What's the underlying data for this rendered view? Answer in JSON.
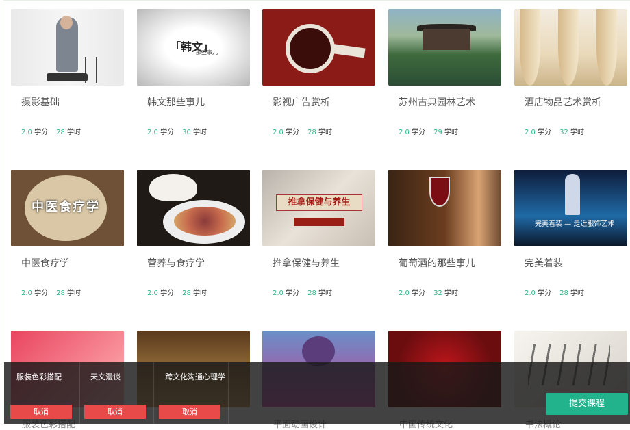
{
  "courses_row1": [
    {
      "title": "摄影基础",
      "credits": "2.0",
      "hours": "28",
      "thumb": "t-photo"
    },
    {
      "title": "韩文那些事儿",
      "credits": "2.0",
      "hours": "30",
      "thumb": "t-hanwen",
      "thumb_text": "「韩文」",
      "thumb_sub": "那些事儿"
    },
    {
      "title": "影视广告赏析",
      "credits": "2.0",
      "hours": "28",
      "thumb": "t-film"
    },
    {
      "title": "苏州古典园林艺术",
      "credits": "2.0",
      "hours": "29",
      "thumb": "t-garden"
    },
    {
      "title": "酒店物品艺术赏析",
      "credits": "2.0",
      "hours": "32",
      "thumb": "t-hotel"
    }
  ],
  "courses_row2": [
    {
      "title": "中医食疗学",
      "credits": "2.0",
      "hours": "28",
      "thumb": "t-tcm",
      "thumb_text": "中医食疗学"
    },
    {
      "title": "营养与食疗学",
      "credits": "2.0",
      "hours": "28",
      "thumb": "t-nutri"
    },
    {
      "title": "推拿保健与养生",
      "credits": "2.0",
      "hours": "28",
      "thumb": "t-massage",
      "thumb_text": "推拿保健与养生"
    },
    {
      "title": "葡萄酒的那些事儿",
      "credits": "2.0",
      "hours": "32",
      "thumb": "t-wine"
    },
    {
      "title": "完美着装",
      "credits": "2.0",
      "hours": "28",
      "thumb": "t-dress",
      "thumb_text": "完美着装 — 走近服饰艺术"
    }
  ],
  "units": {
    "credit": "学分",
    "hour": "学时"
  },
  "selected": [
    {
      "name": "服装色彩搭配",
      "cancel": "取消"
    },
    {
      "name": "天文漫谈",
      "cancel": "取消"
    },
    {
      "name": "跨文化沟通心理学",
      "cancel": "取消"
    }
  ],
  "submit_label": "提交课程",
  "peek_titles": [
    "服装色彩搭配",
    "平面动画设计",
    "中国传统文化",
    "书法概论"
  ]
}
